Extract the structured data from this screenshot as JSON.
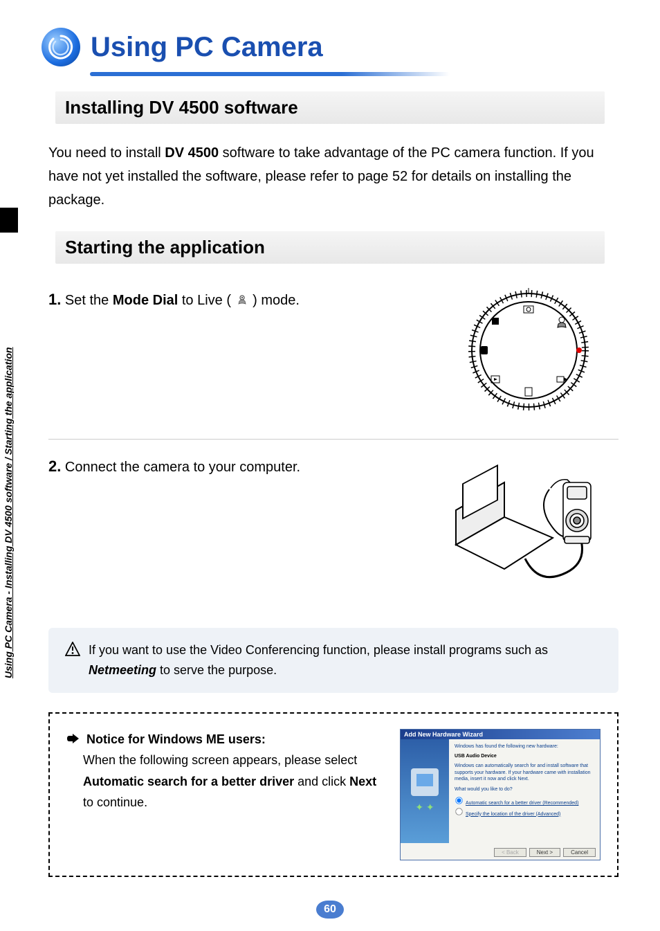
{
  "page_title": "Using PC Camera",
  "section1_heading": "Installing DV 4500 software",
  "intro_prefix": "You need to install ",
  "intro_bold": "DV 4500",
  "intro_suffix": " software to take advantage of the PC camera function. If you have not yet installed the software, please refer to page 52 for details on installing the package.",
  "section2_heading": "Starting the application",
  "step1_num": "1.",
  "step1_prefix": " Set the ",
  "step1_bold": "Mode Dial",
  "step1_mid": " to Live ( ",
  "step1_suffix": " ) mode.",
  "step2_num": "2.",
  "step2_text": " Connect the camera to your computer.",
  "notice_prefix": "If you want to use the Video Conferencing function, please install programs such as ",
  "notice_bold": "Netmeeting",
  "notice_suffix": " to serve the purpose.",
  "me_notice_title": "Notice for Windows ME users:",
  "me_notice_line1_a": "When the following screen appears, please select ",
  "me_notice_line1_b": "Automatic search for a better driver",
  "me_notice_line1_c": " and click ",
  "me_notice_line1_d": "Next",
  "me_notice_line1_e": " to continue.",
  "wizard": {
    "title": "Add New Hardware Wizard",
    "found": "Windows has found the following new hardware:",
    "device": "USB Audio Device",
    "desc": "Windows can automatically search for and install software that supports your hardware. If your hardware came with installation media, insert it now and click Next.",
    "prompt": "What would you like to do?",
    "opt1": "Automatic search for a better driver (Recommended)",
    "opt2": "Specify the location of the driver (Advanced)",
    "back": "< Back",
    "next": "Next >",
    "cancel": "Cancel"
  },
  "side_caption": "Using PC Camera - Installing DV 4500 software / Starting the application",
  "page_number": "60"
}
